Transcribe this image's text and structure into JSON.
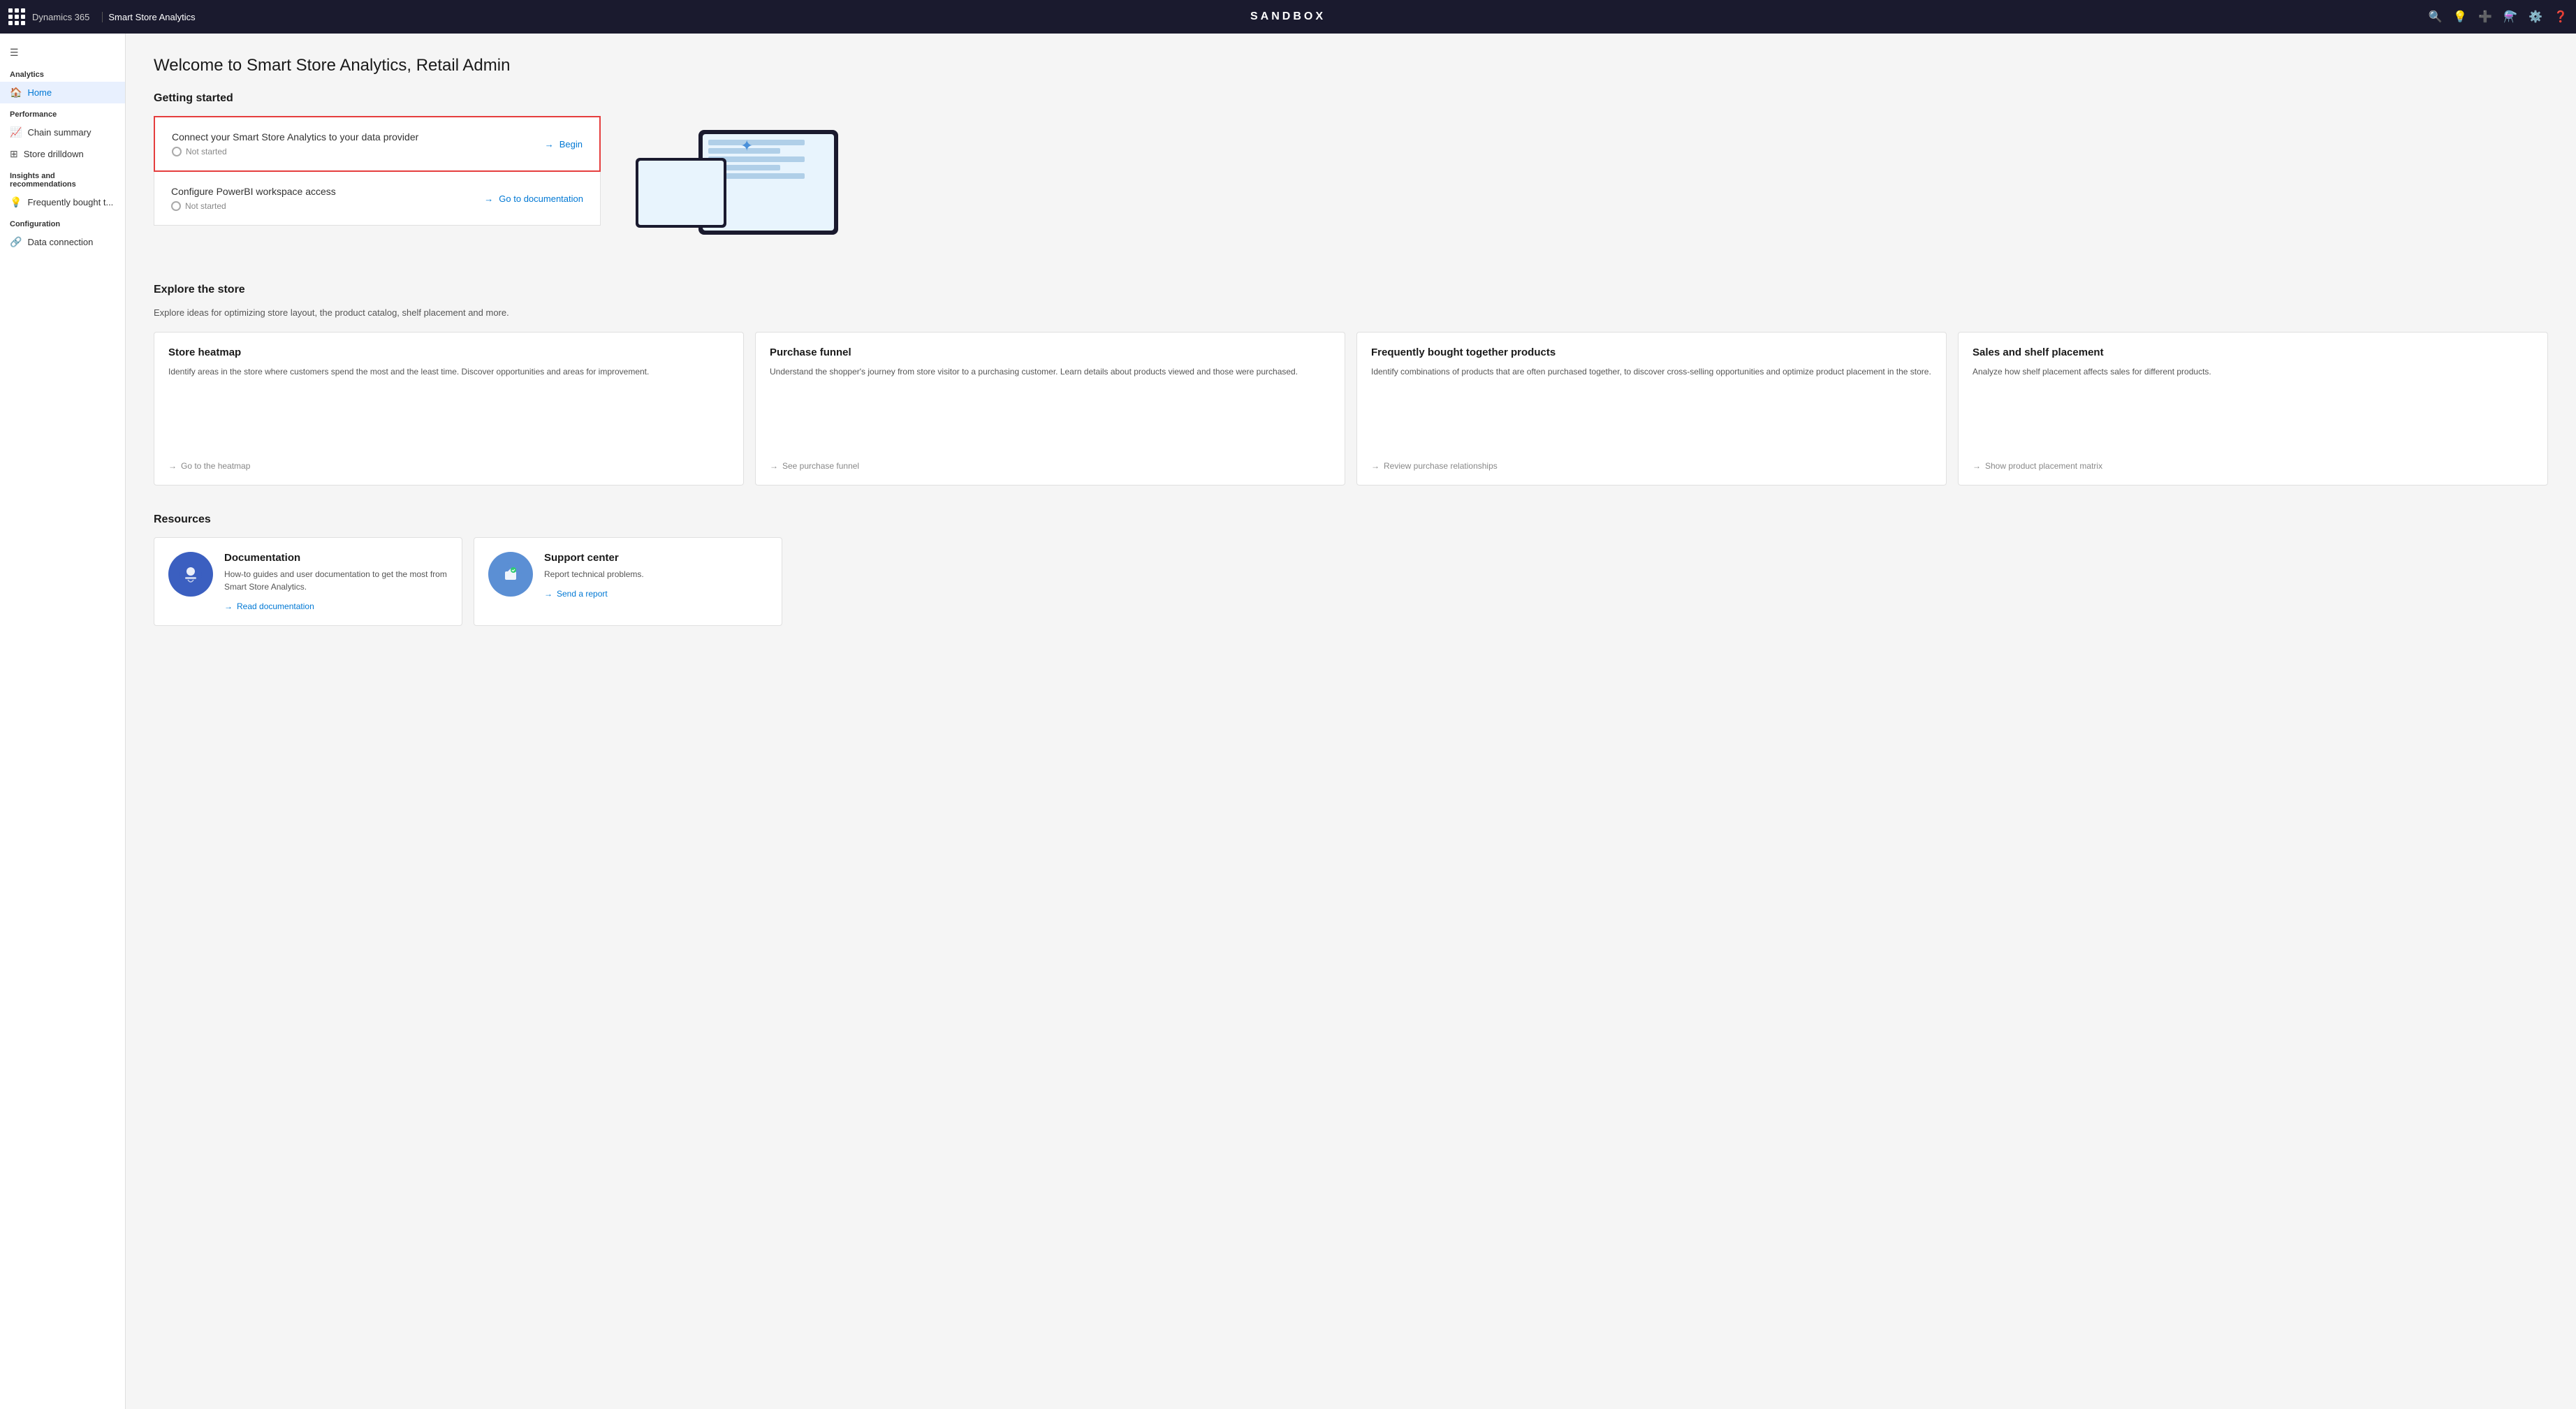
{
  "app": {
    "brand": "Dynamics 365",
    "app_name": "Smart Store Analytics",
    "sandbox_label": "SANDBOX"
  },
  "sidebar": {
    "analytics_label": "Analytics",
    "home_label": "Home",
    "performance_label": "Performance",
    "chain_summary_label": "Chain summary",
    "store_drilldown_label": "Store drilldown",
    "insights_label": "Insights and recommendations",
    "frequently_bought_label": "Frequently bought t...",
    "configuration_label": "Configuration",
    "data_connection_label": "Data connection"
  },
  "main": {
    "page_title": "Welcome to Smart Store Analytics, Retail Admin",
    "getting_started_title": "Getting started",
    "getting_started_cards": [
      {
        "title": "Connect your Smart Store Analytics to your data provider",
        "status": "Not started",
        "action": "Begin",
        "highlighted": true
      },
      {
        "title": "Configure PowerBI workspace access",
        "status": "Not started",
        "action": "Go to documentation",
        "highlighted": false
      }
    ],
    "explore_title": "Explore the store",
    "explore_subtitle": "Explore ideas for optimizing store layout, the product catalog, shelf placement and more.",
    "explore_cards": [
      {
        "title": "Store heatmap",
        "desc": "Identify areas in the store where customers spend the most and the least time. Discover opportunities and areas for improvement.",
        "link": "Go to the heatmap"
      },
      {
        "title": "Purchase funnel",
        "desc": "Understand the shopper's journey from store visitor to a purchasing customer. Learn details about products viewed and those were purchased.",
        "link": "See purchase funnel"
      },
      {
        "title": "Frequently bought together products",
        "desc": "Identify combinations of products that are often purchased together, to discover cross-selling opportunities and optimize product placement in the store.",
        "link": "Review purchase relationships"
      },
      {
        "title": "Sales and shelf placement",
        "desc": "Analyze how shelf placement affects sales for different products.",
        "link": "Show product placement matrix"
      }
    ],
    "resources_title": "Resources",
    "resources": [
      {
        "title": "Documentation",
        "desc": "How-to guides and user documentation to get the most from Smart Store Analytics.",
        "link": "Read documentation",
        "icon": "📡"
      },
      {
        "title": "Support center",
        "desc": "Report technical problems.",
        "link": "Send a report",
        "icon": "📧"
      }
    ]
  }
}
